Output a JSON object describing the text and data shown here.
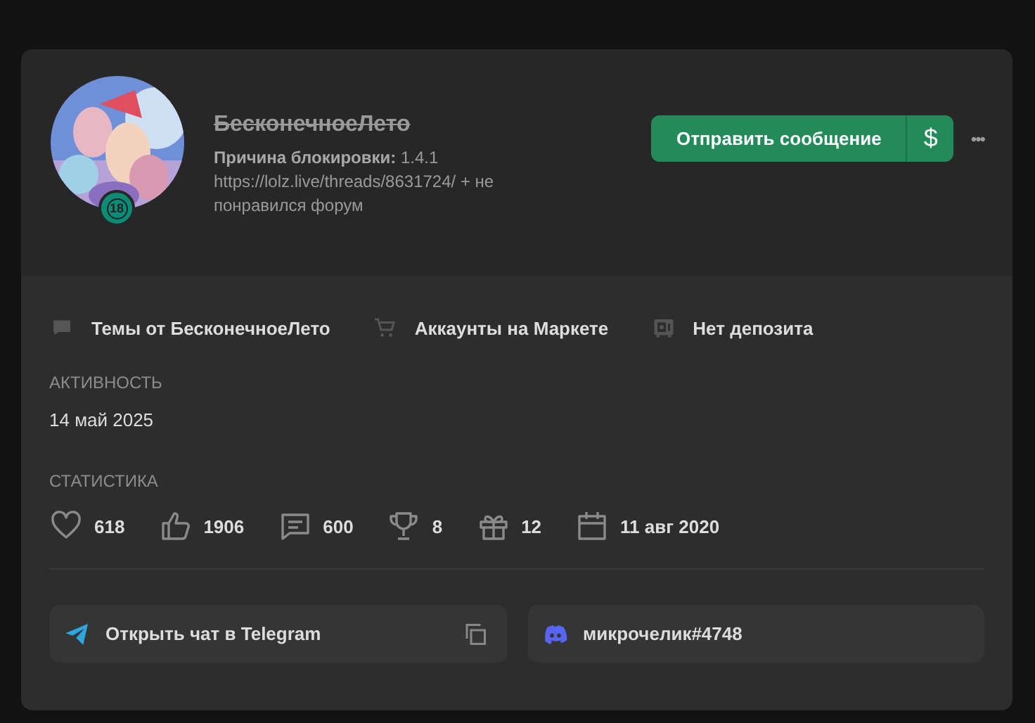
{
  "profile": {
    "username": "БесконечноеЛето",
    "banned": true,
    "ban_reason": "**Причина блокировки:** 1.4.1 https://lolz.live/threads/8631724/ + не понравился форум",
    "badge": "18"
  },
  "actions": {
    "message_button": "Отправить сообщение",
    "money_button": "$",
    "more_button": "•••"
  },
  "links": [
    {
      "kind": "threads",
      "label": "Темы от БесконечноеЛето"
    },
    {
      "kind": "market",
      "label": "Аккаунты на Маркете"
    },
    {
      "kind": "deposit",
      "label": "Нет депозита"
    }
  ],
  "activity": {
    "heading": "АКТИВНОСТЬ",
    "value": "14 май 2025"
  },
  "statistics": {
    "heading": "СТАТИСТИКА",
    "items": [
      {
        "kind": "likes",
        "value": "618"
      },
      {
        "kind": "thumbs",
        "value": "1906"
      },
      {
        "kind": "messages",
        "value": "600"
      },
      {
        "kind": "trophies",
        "value": "8"
      },
      {
        "kind": "gifts",
        "value": "12"
      },
      {
        "kind": "registered",
        "value": "11 авг 2020"
      }
    ]
  },
  "contacts": [
    {
      "kind": "telegram",
      "label": "Открыть чат в Telegram",
      "copyable": true
    },
    {
      "kind": "discord",
      "label": "микрочелик#4748",
      "copyable": false
    }
  ]
}
